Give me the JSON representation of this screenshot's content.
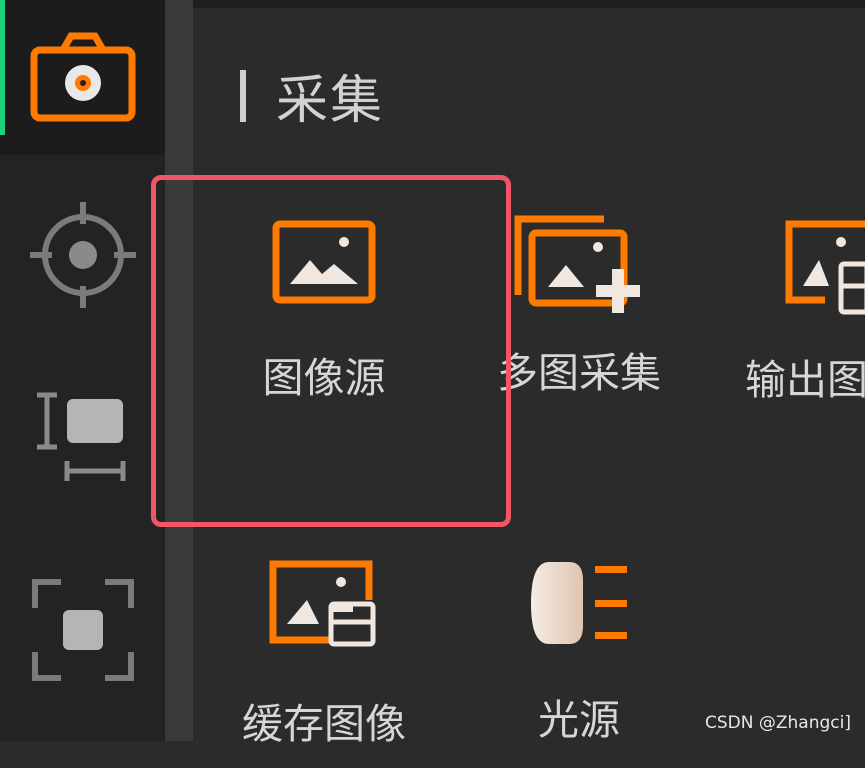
{
  "panel": {
    "title": "采集",
    "tiles": [
      {
        "label": "图像源",
        "icon": "image-source-icon"
      },
      {
        "label": "多图采集",
        "icon": "multi-image-capture-icon"
      },
      {
        "label": "输出图",
        "icon": "output-image-icon"
      },
      {
        "label": "缓存图像",
        "icon": "cache-image-icon"
      },
      {
        "label": "光源",
        "icon": "light-source-icon"
      }
    ]
  },
  "rail": {
    "items": [
      "camera-icon",
      "target-icon",
      "measure-icon",
      "focus-frame-icon"
    ]
  },
  "watermark": "CSDN @Zhangci]",
  "colors": {
    "accent": "#ff7a00",
    "active_indicator": "#21d07a",
    "selection": "#f25567",
    "background": "#2b2b2b"
  }
}
